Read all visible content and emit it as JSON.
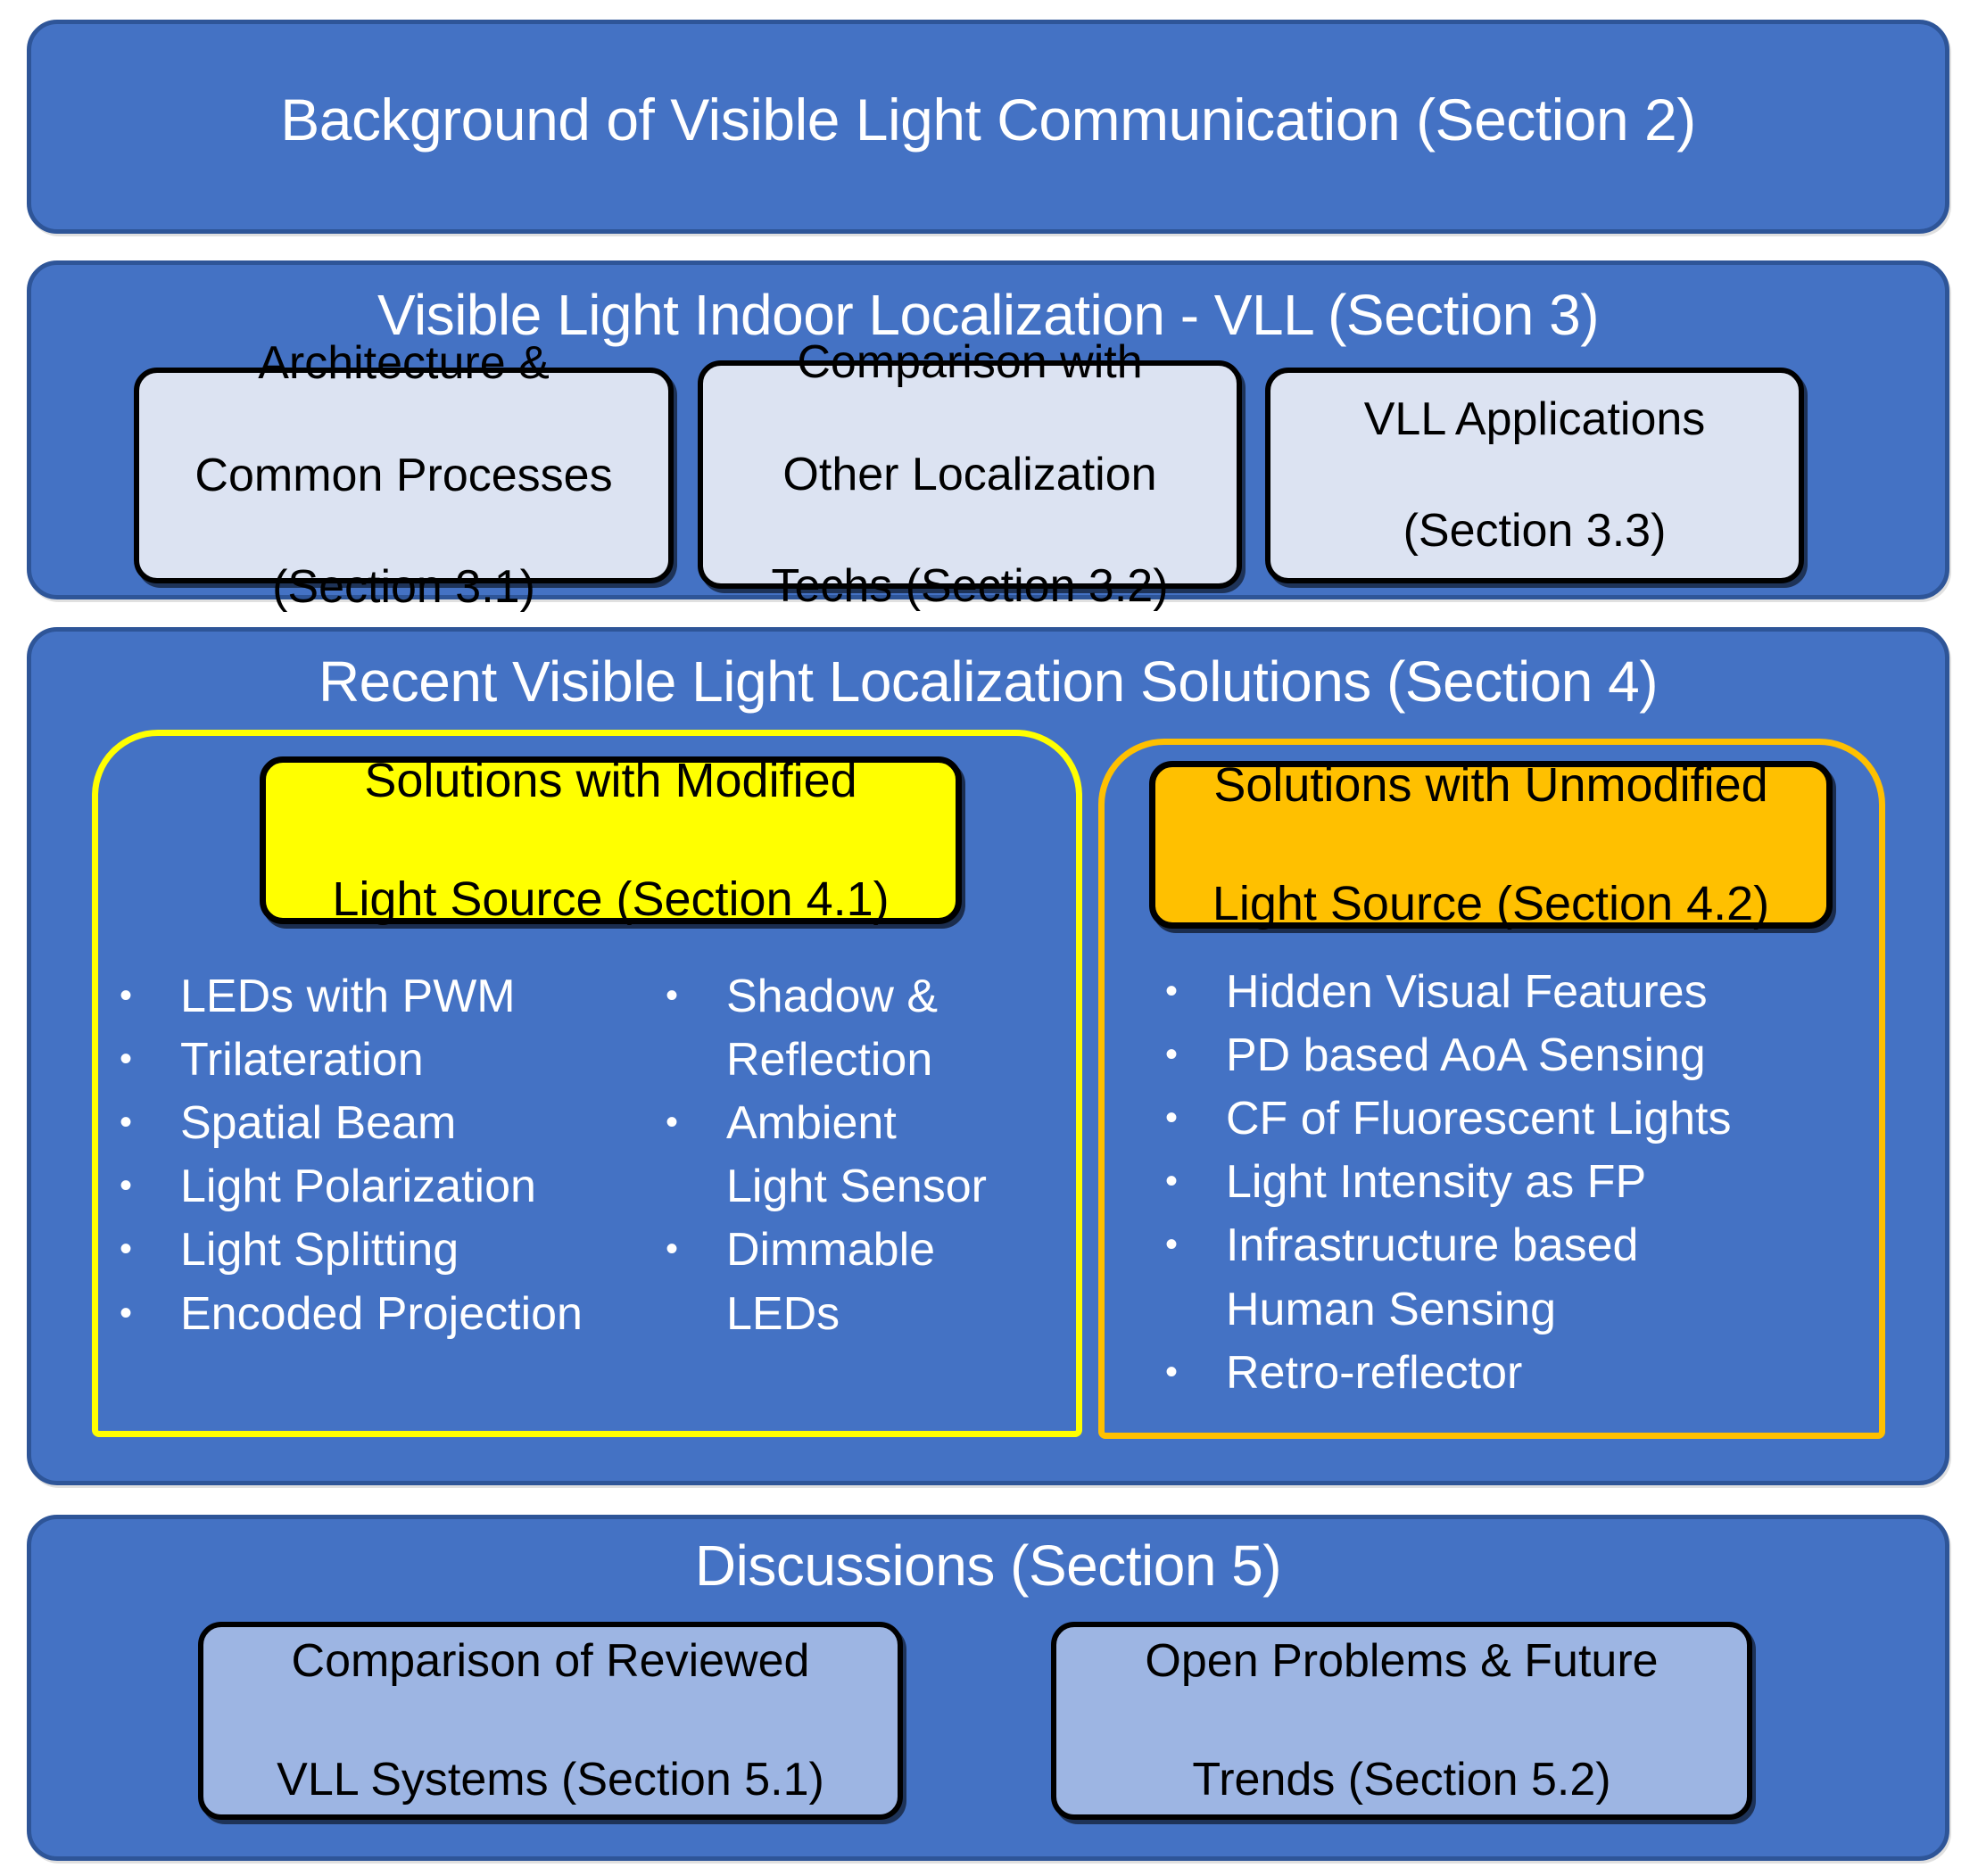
{
  "colors": {
    "panel_fill": "#4472C4",
    "panel_border": "#2E5598",
    "subbox_fill": "#DCE3F2",
    "discussion_box_fill": "#9DB5E3",
    "modified_accent": "#FFFF00",
    "unmodified_accent": "#FFC000",
    "title_text": "#FFFFFF",
    "box_text": "#000000"
  },
  "sections": {
    "background": {
      "title": "Background of Visible Light Communication (Section 2)"
    },
    "vll": {
      "title": "Visible Light Indoor Localization - VLL (Section 3)",
      "boxes": [
        {
          "line1": "Architecture &",
          "line2": "Common Processes",
          "line3": "(Section 3.1)"
        },
        {
          "line1": "Comparison with",
          "line2": "Other Localization",
          "line3": "Techs (Section 3.2)"
        },
        {
          "line1": "VLL Applications",
          "line2": "(Section 3.3)",
          "line3": ""
        }
      ]
    },
    "solutions": {
      "title": "Recent Visible Light Localization Solutions (Section 4)",
      "modified": {
        "chip_line1": "Solutions with Modified",
        "chip_line2": "Light Source (Section 4.1)",
        "bullets_left": [
          "LEDs  with PWM",
          "Trilateration",
          "Spatial Beam",
          "Light Polarization",
          "Light Splitting",
          "Encoded Projection"
        ],
        "bullets_right": [
          {
            "text": "Shadow &",
            "continuation": false
          },
          {
            "text": "Reflection",
            "continuation": true
          },
          {
            "text": "Ambient",
            "continuation": false
          },
          {
            "text": "Light Sensor",
            "continuation": true
          },
          {
            "text": "Dimmable",
            "continuation": false
          },
          {
            "text": "LEDs",
            "continuation": true
          }
        ]
      },
      "unmodified": {
        "chip_line1": "Solutions with Unmodified",
        "chip_line2": "Light Source (Section 4.2)",
        "bullets": [
          {
            "text": "Hidden Visual Features",
            "continuation": false
          },
          {
            "text": "PD based AoA Sensing",
            "continuation": false
          },
          {
            "text": "CF of Fluorescent Lights",
            "continuation": false
          },
          {
            "text": "Light Intensity as FP",
            "continuation": false
          },
          {
            "text": "Infrastructure based",
            "continuation": false
          },
          {
            "text": "Human Sensing",
            "continuation": true
          },
          {
            "text": "Retro-reflector",
            "continuation": false
          }
        ]
      }
    },
    "discussions": {
      "title": "Discussions (Section 5)",
      "boxes": [
        {
          "line1": "Comparison of Reviewed",
          "line2": "VLL Systems (Section 5.1)"
        },
        {
          "line1": "Open Problems & Future",
          "line2": "Trends (Section 5.2)"
        }
      ]
    }
  }
}
